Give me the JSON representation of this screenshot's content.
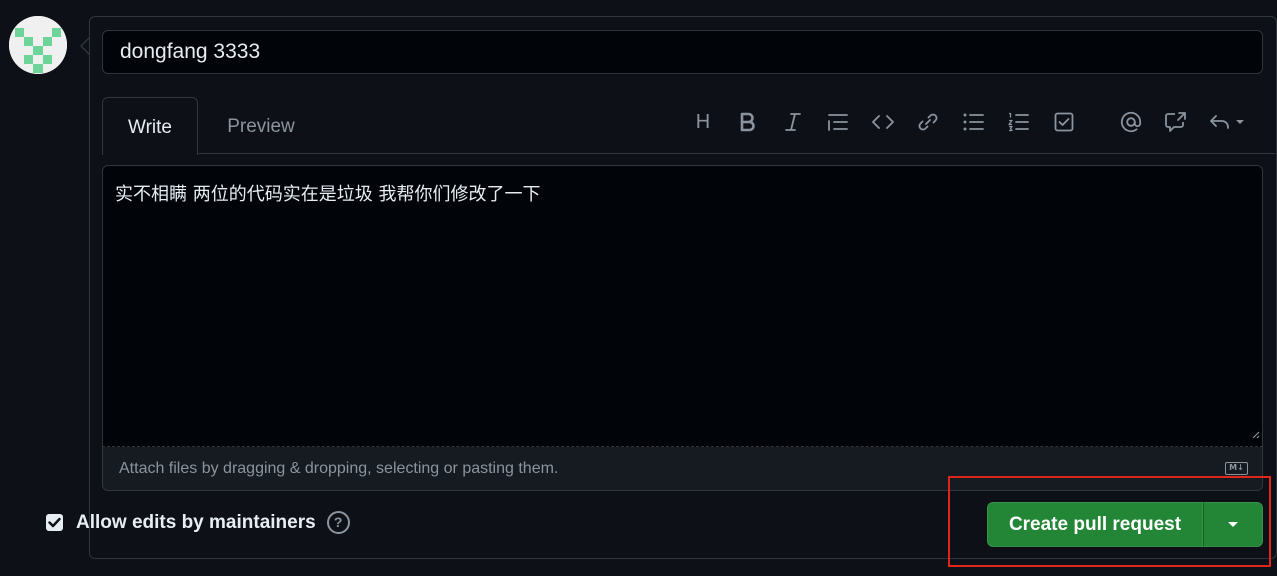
{
  "pr_form": {
    "title_value": "dongfang 3333",
    "tabs": {
      "write": "Write",
      "preview": "Preview"
    },
    "toolbar": {
      "heading_label": "H",
      "icons": [
        "heading-icon",
        "bold-icon",
        "italic-icon",
        "quote-icon",
        "code-icon",
        "link-icon",
        "unordered-list-icon",
        "ordered-list-icon",
        "task-list-icon",
        "mention-icon",
        "cross-reference-icon",
        "reply-icon"
      ]
    },
    "body_text": "实不相瞒 两位的代码实在是垃圾 我帮你们修改了一下",
    "attach_hint": "Attach files by dragging & dropping, selecting or pasting them.",
    "markdown_badge": "M↓",
    "allow_edits_label": "Allow edits by maintainers",
    "allow_edits_checked": true,
    "help_glyph": "?",
    "submit_label": "Create pull request"
  },
  "colors": {
    "background": "#0d1117",
    "input_bg": "#010409",
    "border": "#30363d",
    "text": "#e6edf3",
    "muted": "#8b949e",
    "primary_button": "#238636",
    "annotation_red": "#e0251b",
    "avatar_green": "#6ed49a"
  }
}
